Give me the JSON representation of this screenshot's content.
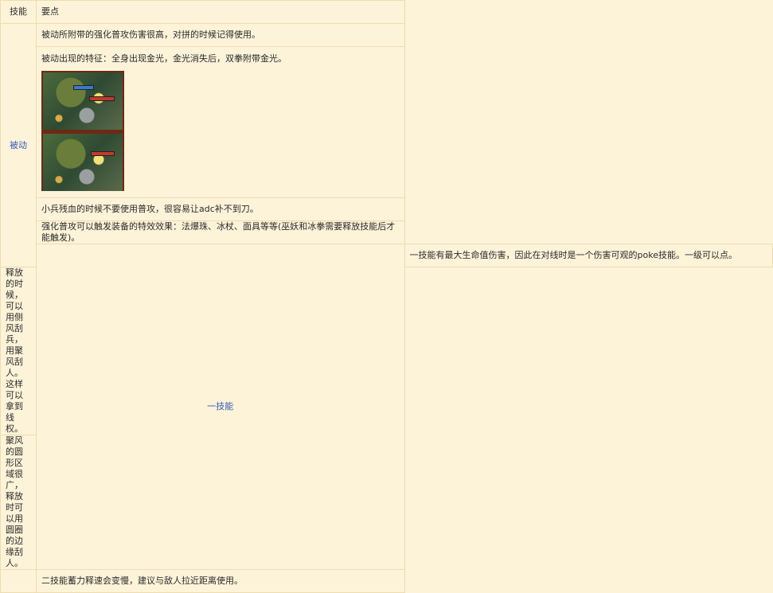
{
  "header": {
    "skill": "技能",
    "points": "要点"
  },
  "groups": [
    {
      "skill": "被动",
      "rows": [
        "被动所附带的强化普攻伤害很高，对拼的时候记得使用。",
        "被动出现的特征：全身出现金光，金光消失后，双拳附带金光。",
        "小兵残血的时候不要使用普攻，很容易让adc补不到刀。",
        "强化普攻可以触发装备的特效效果：法爆珠、冰杖、面具等等(巫妖和冰拳需要释放技能后才能触发)。"
      ]
    },
    {
      "skill": "一技能",
      "rows": [
        "一技能有最大生命值伤害，因此在对线时是一个伤害可观的poke技能。一级可以点。",
        "释放的时候，可以用侧风刮兵，用聚风刮人。这样可以拿到线权。",
        "聚风的圆形区域很广，释放时可以用圆圈的边缘刮人。",
        "二技能蓄力释速会变慢，建议与敌人拉近距离使用。"
      ]
    }
  ],
  "image": {
    "alt": "gameplay-screenshot"
  }
}
